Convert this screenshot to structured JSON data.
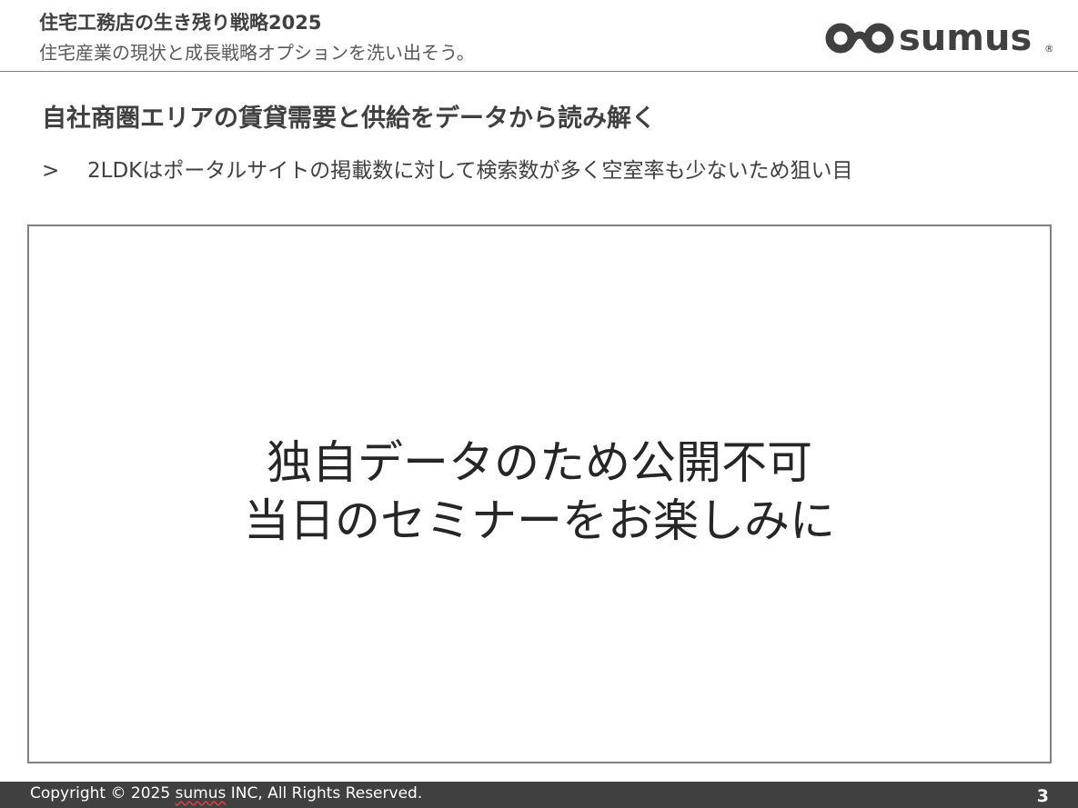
{
  "header": {
    "series_title": "住宅工務店の生き残り戦略2025",
    "series_subtitle": "住宅産業の現状と成長戦略オプションを洗い出そう。",
    "logo": {
      "text": "sumus",
      "registered_mark": "®",
      "color": "#404040"
    }
  },
  "slide": {
    "title": "自社商圏エリアの賃貸需要と供給をデータから読み解く",
    "bullet_marker": ">",
    "bullet_text": "2LDKはポータルサイトの掲載数に対して検索数が多く空室率も少ないため狙い目",
    "notice_line1": "独自データのため公開不可",
    "notice_line2": "当日のセミナーをお楽しみに"
  },
  "footer": {
    "copyright_prefix": "Copyright © 2025 ",
    "copyright_company": "sumus",
    "copyright_suffix": " INC, All Rights Reserved.",
    "page_number": "3",
    "background": "#404040"
  }
}
